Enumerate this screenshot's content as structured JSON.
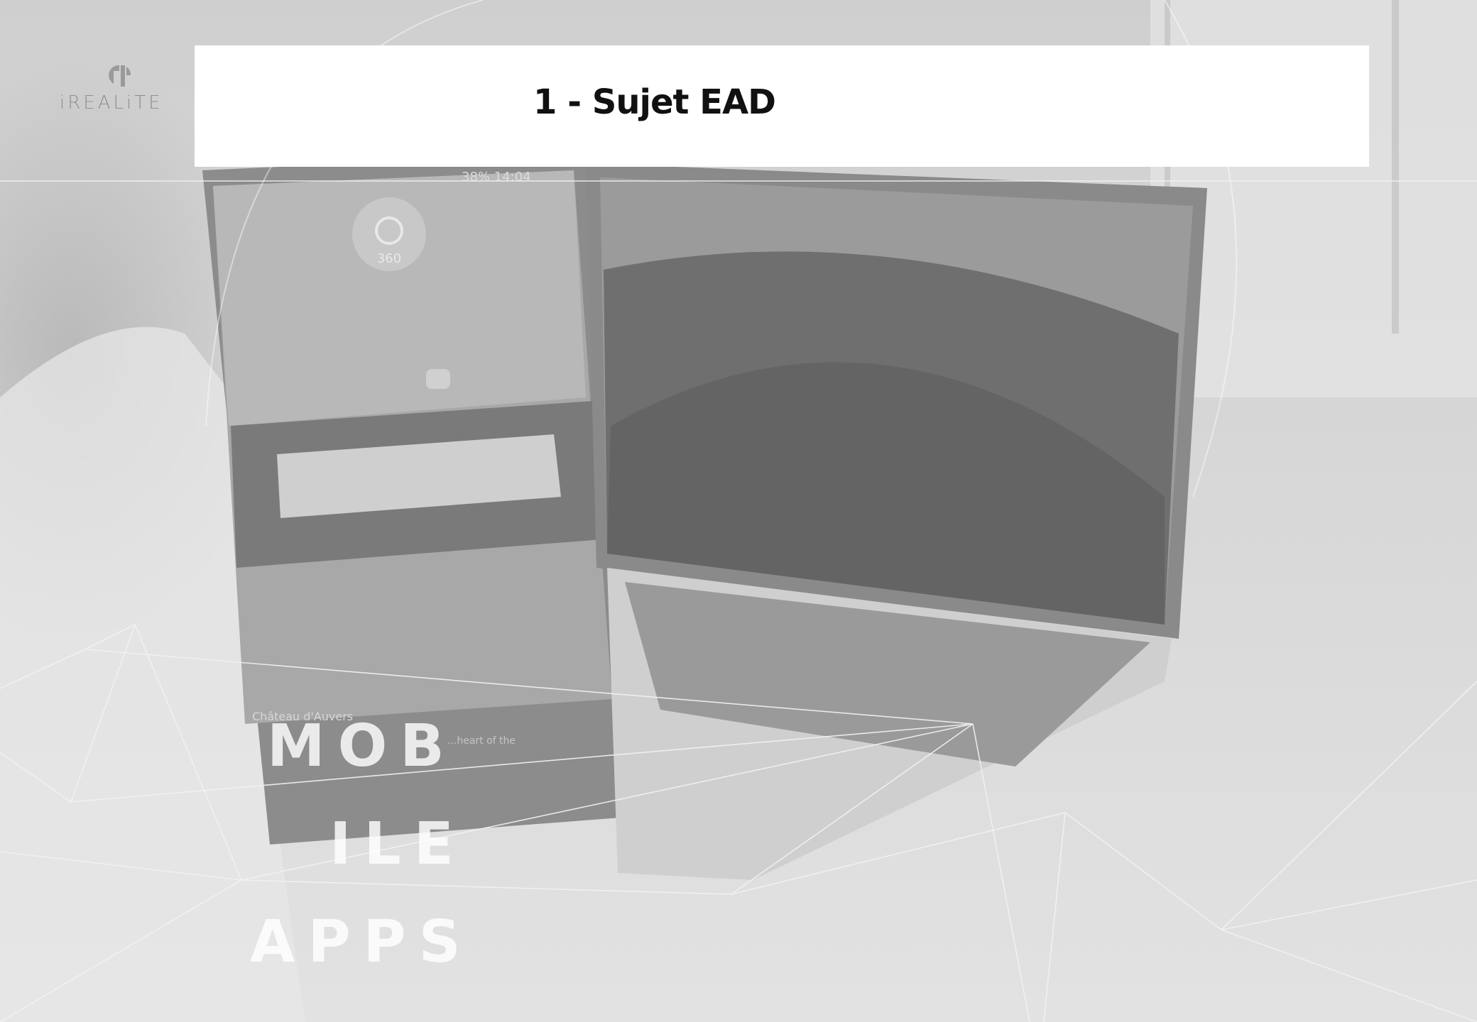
{
  "logo": {
    "text": "iREALiTE",
    "icon": "irealite-logo-icon"
  },
  "slide": {
    "title": "1 - Sujet EAD"
  },
  "overlay": {
    "line1": "MOB",
    "line2": "ILE",
    "line3": "APPS"
  },
  "background": {
    "phone_status": "38% 14:04",
    "phone_badge": "360",
    "phone_caption": "Château d'Auvers",
    "phone_caption2": "...heart of the"
  },
  "colors": {
    "title_bar": "#ffffff",
    "title_text": "#111111",
    "logo": "#9a9a9a"
  }
}
